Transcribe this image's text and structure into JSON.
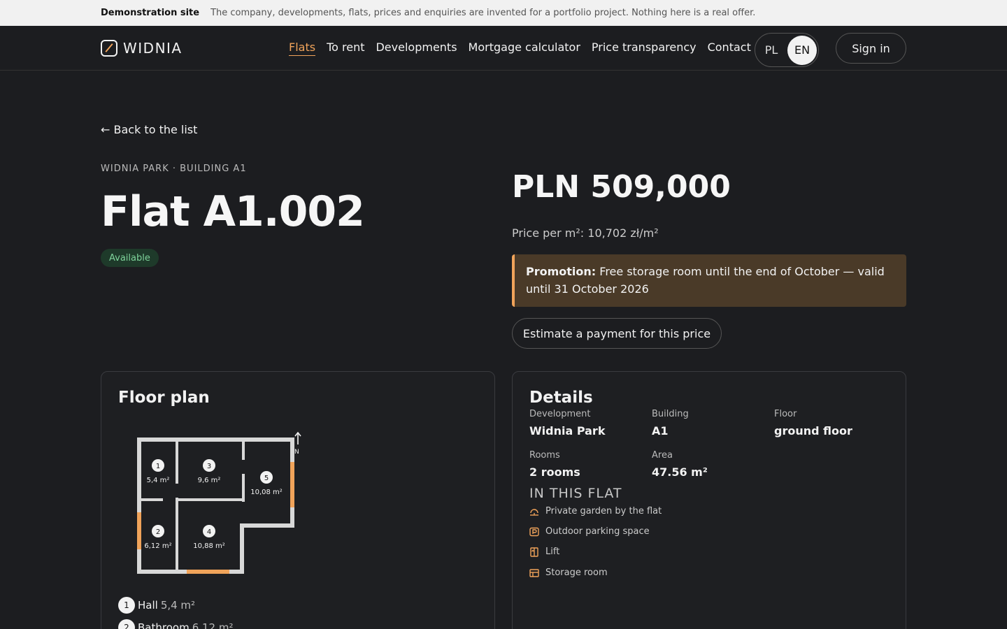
{
  "demo": {
    "label": "Demonstration site",
    "text": "The company, developments, flats, prices and enquiries are invented for a portfolio project. Nothing here is a real offer."
  },
  "header": {
    "logo": "WIDNIA",
    "nav": [
      "Flats",
      "To rent",
      "Developments",
      "Mortgage calculator",
      "Price transparency",
      "Contact"
    ],
    "active_nav": "Flats",
    "lang_pl": "PL",
    "lang_en": "EN",
    "signin": "Sign in"
  },
  "back": "← Back to the list",
  "eyebrow": "WIDNIA PARK · BUILDING A1",
  "title": "Flat A1.002",
  "status": "Available",
  "price": "PLN 509,000",
  "price_per_m2": "Price per m²: 10,702 zł/m²",
  "promo": {
    "label": "Promotion:",
    "text": "Free storage room until the end of October — valid until 31 October 2026"
  },
  "estimate_button": "Estimate a payment for this price",
  "floor_plan": {
    "heading": "Floor plan",
    "north": "N",
    "rooms": [
      {
        "num": "1",
        "area": "5,4 m²"
      },
      {
        "num": "2",
        "area": "6,12 m²"
      },
      {
        "num": "3",
        "area": "9,6 m²"
      },
      {
        "num": "4",
        "area": "10,88 m²"
      },
      {
        "num": "5",
        "area": "10,08 m²"
      }
    ],
    "legend": [
      {
        "num": "1",
        "name": "Hall",
        "area": "5,4 m²"
      },
      {
        "num": "2",
        "name": "Bathroom",
        "area": "6,12 m²"
      }
    ]
  },
  "details": {
    "heading": "Details",
    "development_label": "Development",
    "development": "Widnia Park",
    "building_label": "Building",
    "building": "A1",
    "floor_label": "Floor",
    "floor": "ground floor",
    "rooms_label": "Rooms",
    "rooms": "2 rooms",
    "area_label": "Area",
    "area": "47.56 m²",
    "in_flat_heading": "IN THIS FLAT",
    "features": [
      {
        "icon": "garden-icon",
        "label": "Private garden by the flat"
      },
      {
        "icon": "parking-icon",
        "label": "Outdoor parking space"
      },
      {
        "icon": "lift-icon",
        "label": "Lift"
      },
      {
        "icon": "storage-icon",
        "label": "Storage room"
      }
    ]
  },
  "colors": {
    "accent": "#f0a35a",
    "background": "#1c1d20",
    "available": "#7fd49b"
  }
}
